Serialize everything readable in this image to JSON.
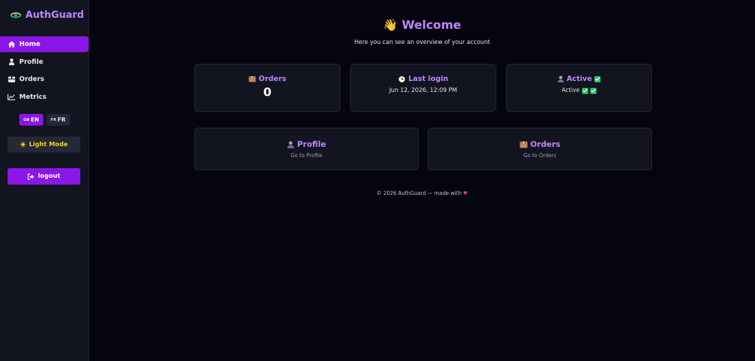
{
  "brand": {
    "name": "AuthGuard",
    "icon": "eye-icon"
  },
  "sidebar": {
    "items": [
      {
        "label": "Home",
        "icon": "home-icon",
        "active": true
      },
      {
        "label": "Profile",
        "icon": "user-icon",
        "active": false
      },
      {
        "label": "Orders",
        "icon": "package-icon",
        "active": false
      },
      {
        "label": "Metrics",
        "icon": "chart-icon",
        "active": false
      }
    ],
    "languages": [
      {
        "code": "GB",
        "label": "EN",
        "active": true
      },
      {
        "code": "FR",
        "label": "FR",
        "active": false
      }
    ],
    "mode_label": "Light Mode",
    "logout_label": "logout"
  },
  "main": {
    "title": "Welcome",
    "subtitle": "Here you can see an overview of your account",
    "cards": {
      "orders": {
        "title": "Orders",
        "value": "0"
      },
      "last_login": {
        "title": "Last login",
        "value": "Jun 12, 2026, 12:09 PM"
      },
      "status": {
        "title": "Active",
        "value": "Active"
      }
    },
    "links": {
      "profile": {
        "title": "Profile",
        "subtitle": "Go to Profile"
      },
      "orders": {
        "title": "Orders",
        "subtitle": "Go to Orders"
      }
    },
    "footer": "© 2026 AuthGuard — made with"
  },
  "colors": {
    "accent": "#8b16e8",
    "accent_text": "#c084fc",
    "background": "#05050f",
    "panel": "#121420"
  }
}
